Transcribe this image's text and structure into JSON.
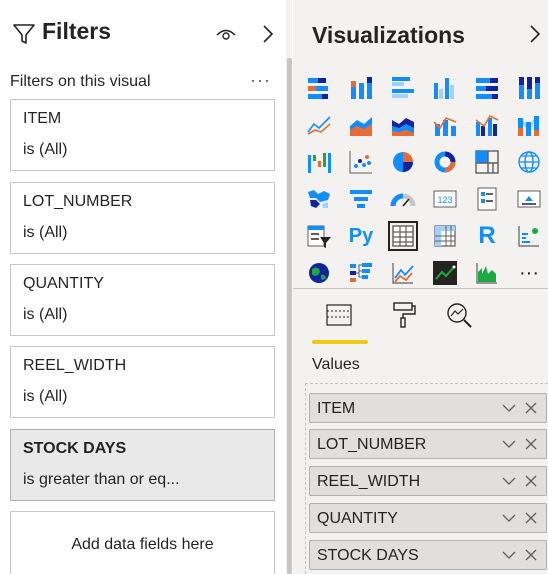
{
  "filters": {
    "title": "Filters",
    "section_label": "Filters on this visual",
    "more_label": "···",
    "cards": [
      {
        "name": "ITEM",
        "value": "is (All)",
        "active": false
      },
      {
        "name": "LOT_NUMBER",
        "value": "is (All)",
        "active": false
      },
      {
        "name": "QUANTITY",
        "value": "is (All)",
        "active": false
      },
      {
        "name": "REEL_WIDTH",
        "value": "is (All)",
        "active": false
      },
      {
        "name": "STOCK DAYS",
        "value": "is greater than or eq...",
        "active": true
      }
    ],
    "add_fields": "Add data fields here"
  },
  "visualizations": {
    "title": "Visualizations",
    "icons": [
      "stacked-bar-chart-icon",
      "stacked-column-chart-icon",
      "clustered-bar-chart-icon",
      "clustered-column-chart-icon",
      "100-stacked-bar-chart-icon",
      "100-stacked-column-chart-icon",
      "line-chart-icon",
      "area-chart-icon",
      "stacked-area-chart-icon",
      "line-and-stacked-column-chart-icon",
      "line-and-clustered-column-chart-icon",
      "ribbon-chart-icon",
      "waterfall-chart-icon",
      "scatter-chart-icon",
      "pie-chart-icon",
      "donut-chart-icon",
      "treemap-icon",
      "map-icon",
      "filled-map-icon",
      "funnel-icon",
      "gauge-icon",
      "card-icon",
      "multi-row-card-icon",
      "kpi-icon",
      "slicer-icon",
      "python-visual-icon",
      "table-icon",
      "matrix-icon",
      "r-visual-icon",
      "key-influencers-icon",
      "arcgis-map-icon",
      "decomposition-tree-icon",
      "qa-icon",
      "smart-narrative-icon",
      "paginated-report-icon",
      "more-visuals-icon"
    ],
    "selected_icon": "table-icon",
    "card_text": "123",
    "python_text": "Py",
    "r_text": "R",
    "more_text": "···",
    "tabs": [
      "fields-tab",
      "format-tab",
      "analytics-tab"
    ],
    "values_label": "Values",
    "fields": [
      "ITEM",
      "LOT_NUMBER",
      "REEL_WIDTH",
      "QUANTITY",
      "STOCK DAYS"
    ],
    "colors": {
      "accent": "#f2c811",
      "blue": "#118dff",
      "navy": "#12239e",
      "orange": "#e66c37"
    }
  }
}
